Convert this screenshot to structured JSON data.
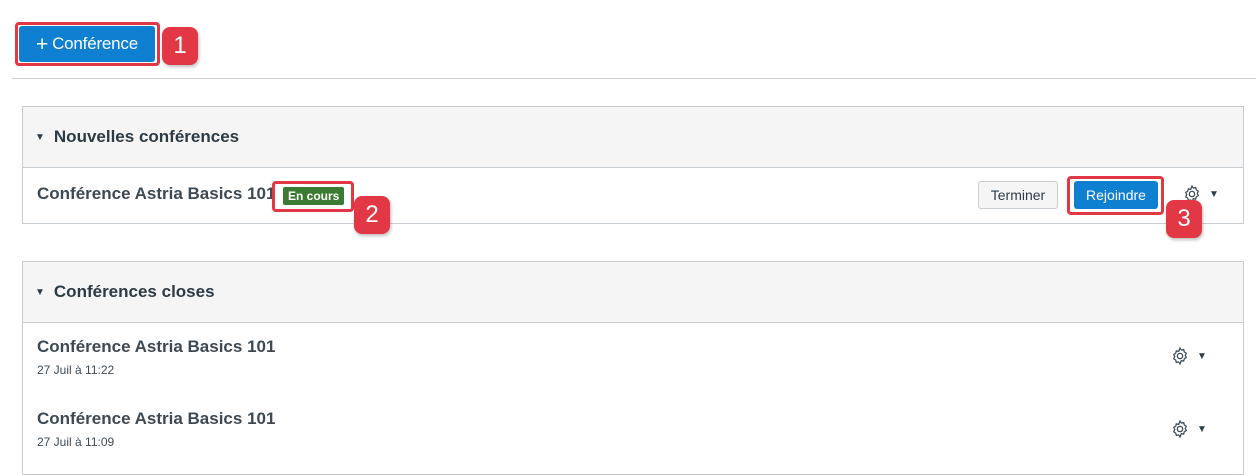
{
  "toolbar": {
    "add_conference_icon": "+",
    "add_conference_label": "Conférence"
  },
  "callouts": [
    "1",
    "2",
    "3"
  ],
  "new_section": {
    "toggle_icon": "▼",
    "title": "Nouvelles conférences",
    "items": [
      {
        "title": "Conférence Astria Basics 101",
        "status": "En cours",
        "end_label": "Terminer",
        "join_label": "Rejoindre",
        "settings_icon": "gear-icon",
        "caret": "▼"
      }
    ]
  },
  "closed_section": {
    "toggle_icon": "▼",
    "title": "Conférences closes",
    "items": [
      {
        "title": "Conférence Astria Basics 101",
        "date": "27 Juil à 11:22",
        "caret": "▼"
      },
      {
        "title": "Conférence Astria Basics 101",
        "date": "27 Juil à 11:09",
        "caret": "▼"
      }
    ]
  },
  "colors": {
    "primary": "#0e7fd1",
    "callout": "#e23744",
    "status_green": "#3b7a32",
    "text": "#2d3b45",
    "border": "#c7cdd1",
    "header_bg": "#f5f5f5"
  }
}
